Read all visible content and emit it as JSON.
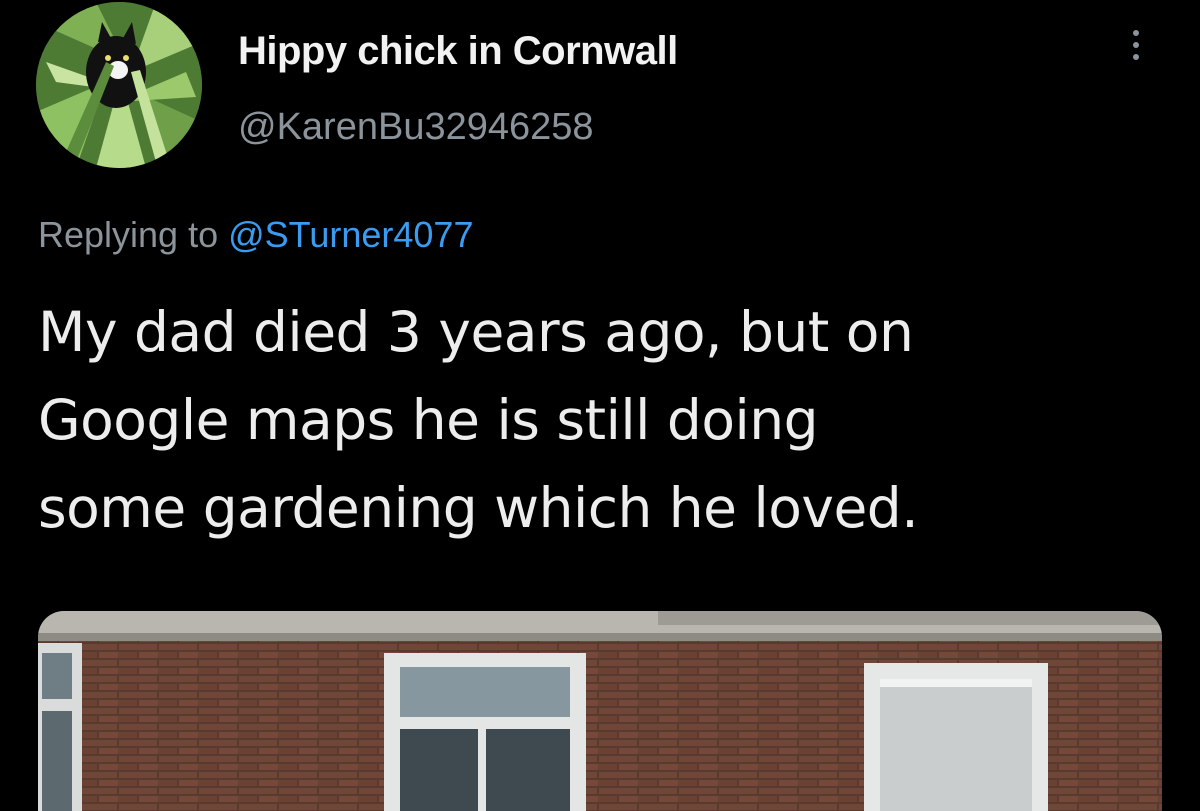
{
  "author": {
    "display_name": "Hippy chick in Cornwall",
    "handle": "@KarenBu32946258",
    "avatar_icon": "cat-in-plants-avatar"
  },
  "reply": {
    "prefix": "Replying to",
    "mention": "@STurner4077"
  },
  "tweet": {
    "line_1": "My dad died 3 years ago, but on",
    "line_2": "Google maps he is still doing",
    "line_3": "some gardening which he loved."
  },
  "media": {
    "icon": "house-street-view-photo"
  },
  "colors": {
    "background": "#000000",
    "name_text": "#f2f2f2",
    "secondary_text": "#8b939b",
    "link": "#3a9cf0",
    "body_text": "#ededed"
  }
}
